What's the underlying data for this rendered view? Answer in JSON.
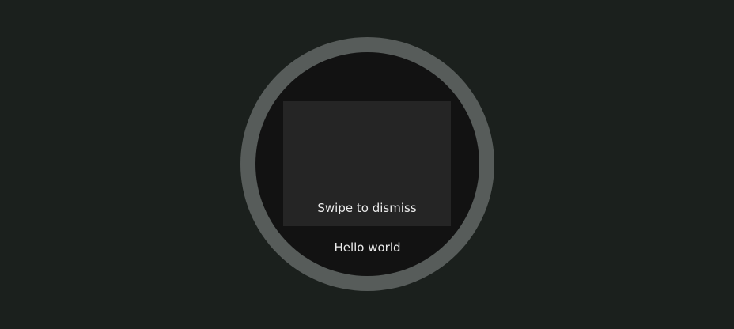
{
  "colors": {
    "background": "#1b201d",
    "bezel": "#575c5a",
    "screen": "#121212",
    "card": "#252525",
    "text": "#ececec"
  },
  "swipe_dismiss": {
    "label": "Swipe to dismiss"
  },
  "content": {
    "text": "Hello world"
  }
}
